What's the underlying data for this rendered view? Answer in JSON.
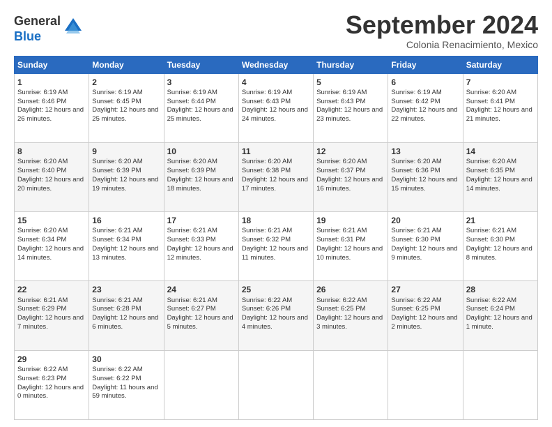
{
  "logo": {
    "general": "General",
    "blue": "Blue"
  },
  "title": "September 2024",
  "subtitle": "Colonia Renacimiento, Mexico",
  "headers": [
    "Sunday",
    "Monday",
    "Tuesday",
    "Wednesday",
    "Thursday",
    "Friday",
    "Saturday"
  ],
  "weeks": [
    [
      {
        "day": "1",
        "sunrise": "6:19 AM",
        "sunset": "6:46 PM",
        "daylight": "12 hours and 26 minutes."
      },
      {
        "day": "2",
        "sunrise": "6:19 AM",
        "sunset": "6:45 PM",
        "daylight": "12 hours and 25 minutes."
      },
      {
        "day": "3",
        "sunrise": "6:19 AM",
        "sunset": "6:44 PM",
        "daylight": "12 hours and 25 minutes."
      },
      {
        "day": "4",
        "sunrise": "6:19 AM",
        "sunset": "6:43 PM",
        "daylight": "12 hours and 24 minutes."
      },
      {
        "day": "5",
        "sunrise": "6:19 AM",
        "sunset": "6:43 PM",
        "daylight": "12 hours and 23 minutes."
      },
      {
        "day": "6",
        "sunrise": "6:19 AM",
        "sunset": "6:42 PM",
        "daylight": "12 hours and 22 minutes."
      },
      {
        "day": "7",
        "sunrise": "6:20 AM",
        "sunset": "6:41 PM",
        "daylight": "12 hours and 21 minutes."
      }
    ],
    [
      {
        "day": "8",
        "sunrise": "6:20 AM",
        "sunset": "6:40 PM",
        "daylight": "12 hours and 20 minutes."
      },
      {
        "day": "9",
        "sunrise": "6:20 AM",
        "sunset": "6:39 PM",
        "daylight": "12 hours and 19 minutes."
      },
      {
        "day": "10",
        "sunrise": "6:20 AM",
        "sunset": "6:39 PM",
        "daylight": "12 hours and 18 minutes."
      },
      {
        "day": "11",
        "sunrise": "6:20 AM",
        "sunset": "6:38 PM",
        "daylight": "12 hours and 17 minutes."
      },
      {
        "day": "12",
        "sunrise": "6:20 AM",
        "sunset": "6:37 PM",
        "daylight": "12 hours and 16 minutes."
      },
      {
        "day": "13",
        "sunrise": "6:20 AM",
        "sunset": "6:36 PM",
        "daylight": "12 hours and 15 minutes."
      },
      {
        "day": "14",
        "sunrise": "6:20 AM",
        "sunset": "6:35 PM",
        "daylight": "12 hours and 14 minutes."
      }
    ],
    [
      {
        "day": "15",
        "sunrise": "6:20 AM",
        "sunset": "6:34 PM",
        "daylight": "12 hours and 14 minutes."
      },
      {
        "day": "16",
        "sunrise": "6:21 AM",
        "sunset": "6:34 PM",
        "daylight": "12 hours and 13 minutes."
      },
      {
        "day": "17",
        "sunrise": "6:21 AM",
        "sunset": "6:33 PM",
        "daylight": "12 hours and 12 minutes."
      },
      {
        "day": "18",
        "sunrise": "6:21 AM",
        "sunset": "6:32 PM",
        "daylight": "12 hours and 11 minutes."
      },
      {
        "day": "19",
        "sunrise": "6:21 AM",
        "sunset": "6:31 PM",
        "daylight": "12 hours and 10 minutes."
      },
      {
        "day": "20",
        "sunrise": "6:21 AM",
        "sunset": "6:30 PM",
        "daylight": "12 hours and 9 minutes."
      },
      {
        "day": "21",
        "sunrise": "6:21 AM",
        "sunset": "6:30 PM",
        "daylight": "12 hours and 8 minutes."
      }
    ],
    [
      {
        "day": "22",
        "sunrise": "6:21 AM",
        "sunset": "6:29 PM",
        "daylight": "12 hours and 7 minutes."
      },
      {
        "day": "23",
        "sunrise": "6:21 AM",
        "sunset": "6:28 PM",
        "daylight": "12 hours and 6 minutes."
      },
      {
        "day": "24",
        "sunrise": "6:21 AM",
        "sunset": "6:27 PM",
        "daylight": "12 hours and 5 minutes."
      },
      {
        "day": "25",
        "sunrise": "6:22 AM",
        "sunset": "6:26 PM",
        "daylight": "12 hours and 4 minutes."
      },
      {
        "day": "26",
        "sunrise": "6:22 AM",
        "sunset": "6:25 PM",
        "daylight": "12 hours and 3 minutes."
      },
      {
        "day": "27",
        "sunrise": "6:22 AM",
        "sunset": "6:25 PM",
        "daylight": "12 hours and 2 minutes."
      },
      {
        "day": "28",
        "sunrise": "6:22 AM",
        "sunset": "6:24 PM",
        "daylight": "12 hours and 1 minute."
      }
    ],
    [
      {
        "day": "29",
        "sunrise": "6:22 AM",
        "sunset": "6:23 PM",
        "daylight": "12 hours and 0 minutes."
      },
      {
        "day": "30",
        "sunrise": "6:22 AM",
        "sunset": "6:22 PM",
        "daylight": "11 hours and 59 minutes."
      },
      null,
      null,
      null,
      null,
      null
    ]
  ]
}
